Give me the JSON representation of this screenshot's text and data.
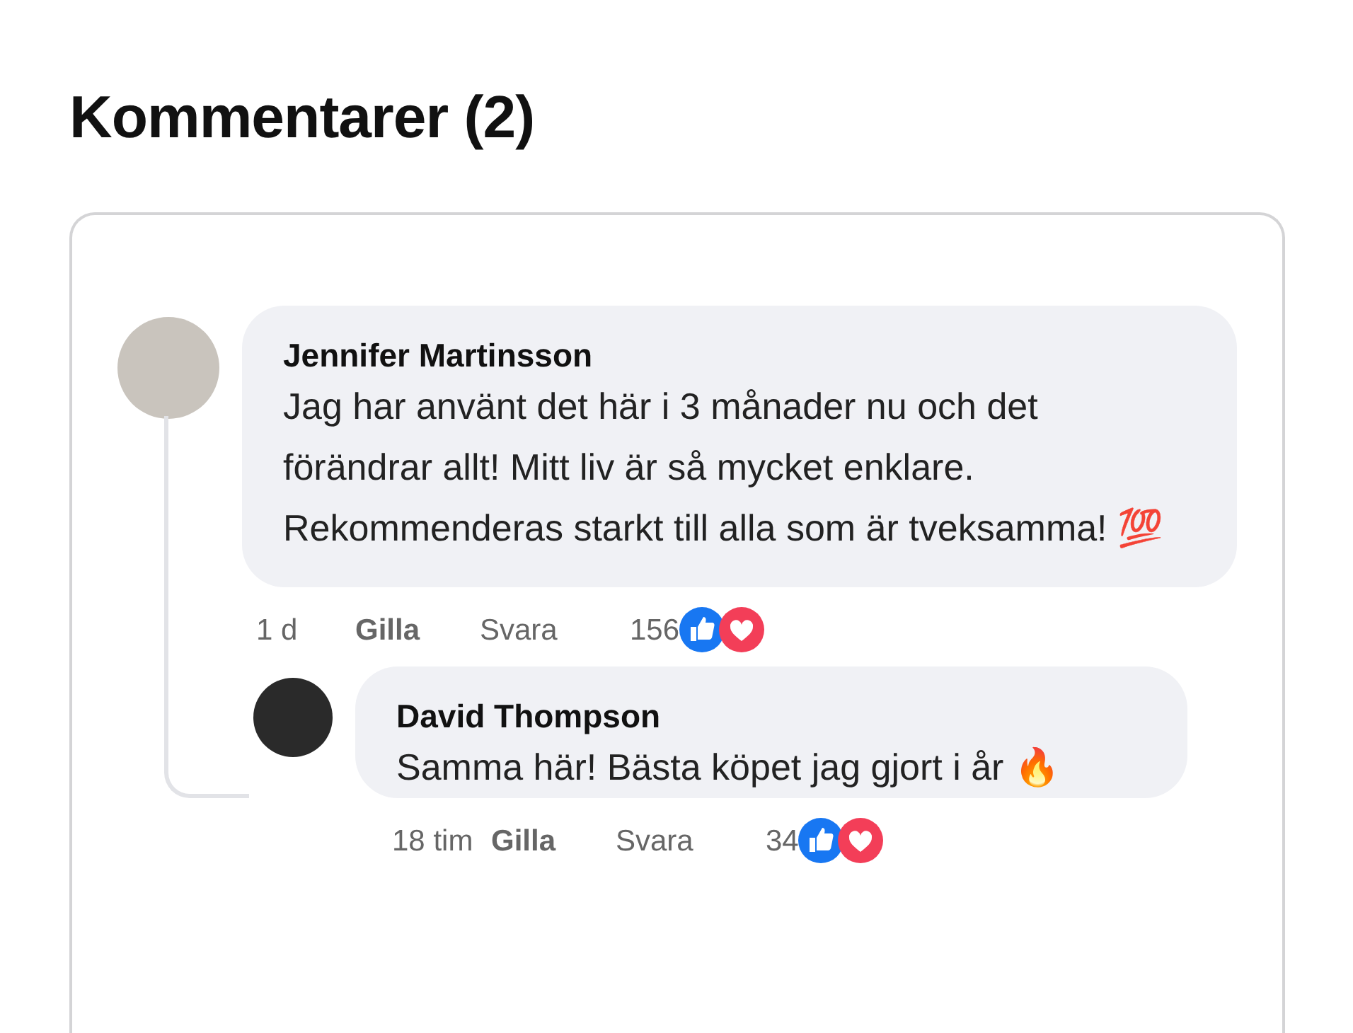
{
  "title": "Kommentarer (2)",
  "comments": [
    {
      "author": "Jennifer Martinsson",
      "text": "Jag har använt det här i 3 månader nu och det förändrar allt! Mitt liv är så mycket enklare. Rekommenderas starkt till alla som är tveksamma! 💯",
      "time": "1 d",
      "like": "Gilla",
      "reply": "Svara",
      "count": "156",
      "replies": [
        {
          "author": "David Thompson",
          "text": "Samma här! Bästa köpet jag gjort i år 🔥",
          "time": "18 tim",
          "like": "Gilla",
          "reply": "Svara",
          "count": "34"
        }
      ]
    }
  ]
}
